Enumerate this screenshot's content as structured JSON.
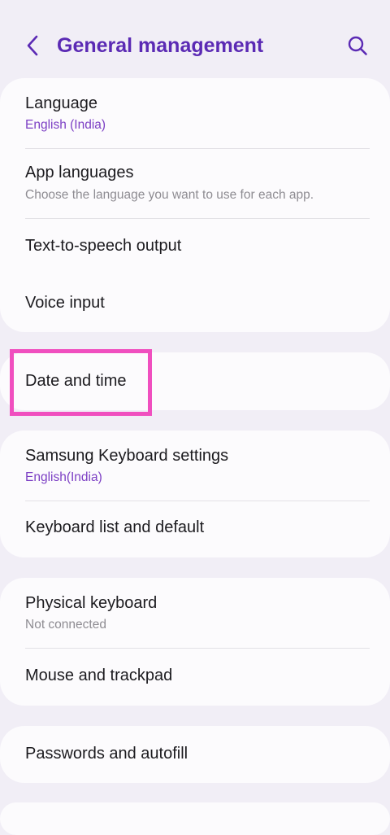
{
  "header": {
    "title": "General management",
    "back_icon": "chevron-left-icon",
    "search_icon": "search-icon"
  },
  "colors": {
    "accent": "#5b2ab4",
    "subtitle_accent": "#7c3fc4",
    "highlight": "#f04fbf",
    "background": "#f1eef6",
    "card": "#fcfbfd"
  },
  "groups": [
    {
      "items": [
        {
          "title": "Language",
          "subtitle": "English (India)"
        },
        {
          "title": "App languages",
          "subtitle": "Choose the language you want to use for each app."
        },
        {
          "title": "Text-to-speech output"
        },
        {
          "title": "Voice input"
        }
      ]
    },
    {
      "items": [
        {
          "title": "Date and time"
        }
      ]
    },
    {
      "items": [
        {
          "title": "Samsung Keyboard settings",
          "subtitle": "English(India)"
        },
        {
          "title": "Keyboard list and default"
        }
      ]
    },
    {
      "items": [
        {
          "title": "Physical keyboard",
          "subtitle": "Not connected"
        },
        {
          "title": "Mouse and trackpad"
        }
      ]
    },
    {
      "items": [
        {
          "title": "Passwords and autofill"
        }
      ]
    }
  ]
}
